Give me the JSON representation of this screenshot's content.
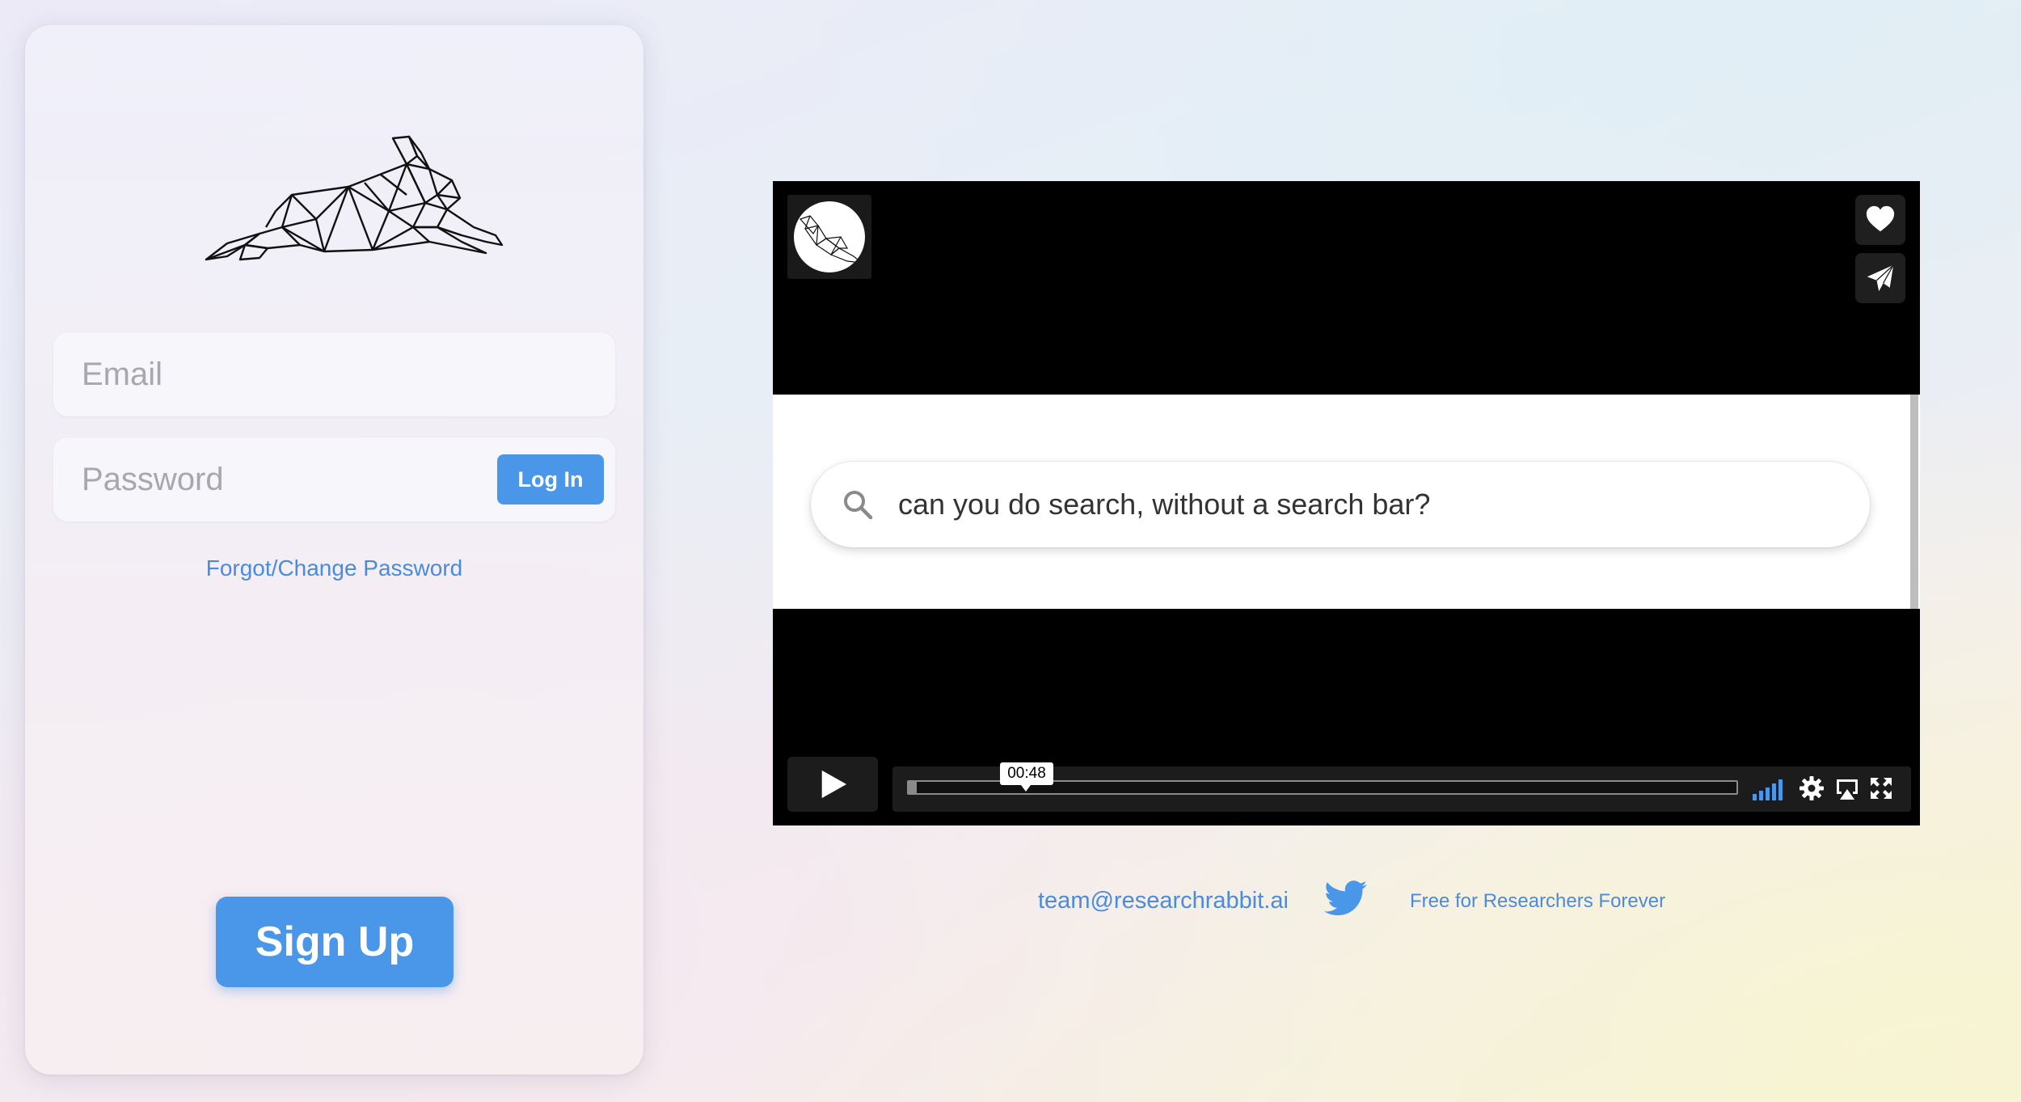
{
  "login": {
    "email_placeholder": "Email",
    "password_placeholder": "Password",
    "login_label": "Log In",
    "forgot_label": "Forgot/Change Password",
    "signup_label": "Sign Up"
  },
  "video": {
    "frame_search_text": "can you do search, without a search bar?",
    "current_time": "00:48",
    "progress": 0.01,
    "volume_level": 1.0
  },
  "footer": {
    "email": "team@researchrabbit.ai",
    "tagline": "Free for Researchers Forever"
  },
  "colors": {
    "accent": "#4a97ea",
    "link": "#4a8bdc",
    "player_bg": "#000000"
  },
  "icons": {
    "logo": "rabbit-logo-icon",
    "like": "heart-icon",
    "share": "paper-plane-icon",
    "play": "play-icon",
    "volume": "volume-bars-icon",
    "settings": "gear-icon",
    "airplay": "airplay-icon",
    "fullscreen": "fullscreen-icon",
    "twitter": "twitter-bird-icon",
    "search": "magnifier-icon"
  }
}
